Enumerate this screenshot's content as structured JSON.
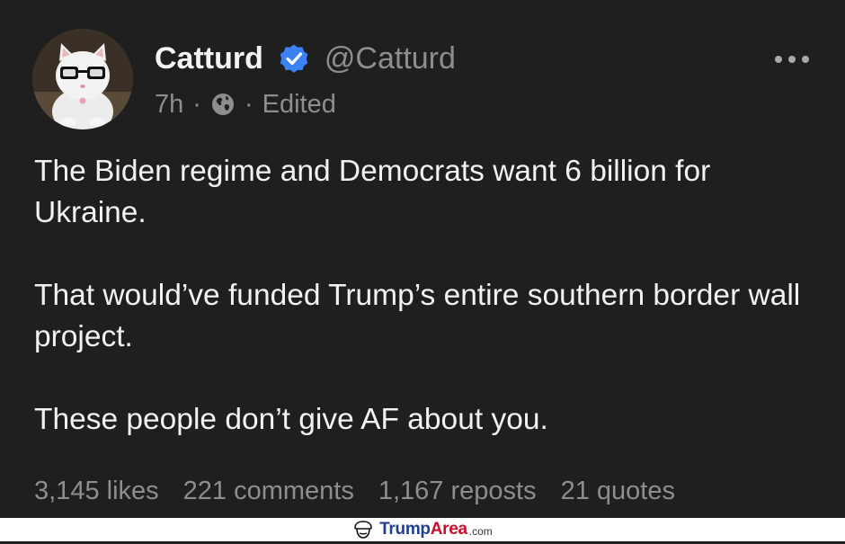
{
  "post": {
    "display_name": "Catturd",
    "handle": "@Catturd",
    "time": "7h",
    "dot1": "·",
    "dot2": "·",
    "edited": "Edited",
    "paragraphs": [
      "The Biden regime and Democrats want 6 billion for Ukraine.",
      "That would’ve funded Trump’s entire southern border wall project.",
      "These people don’t give AF about you."
    ],
    "stats": {
      "likes": "3,145 likes",
      "comments": "221 comments",
      "reposts": "1,167 reposts",
      "quotes": "21 quotes"
    },
    "icons": {
      "verified": "verified-badge-icon",
      "globe": "globe-icon",
      "more": "more-options-icon"
    }
  },
  "watermark": {
    "brand_a": "Trump",
    "brand_b": "Area",
    "tld": ".com"
  },
  "colors": {
    "background": "#1f1f1f",
    "text": "#f2f2f2",
    "muted": "#8e8e8e",
    "verified": "#3b82f6",
    "watermark_blue": "#1f3f8f",
    "watermark_red": "#c8102e"
  }
}
